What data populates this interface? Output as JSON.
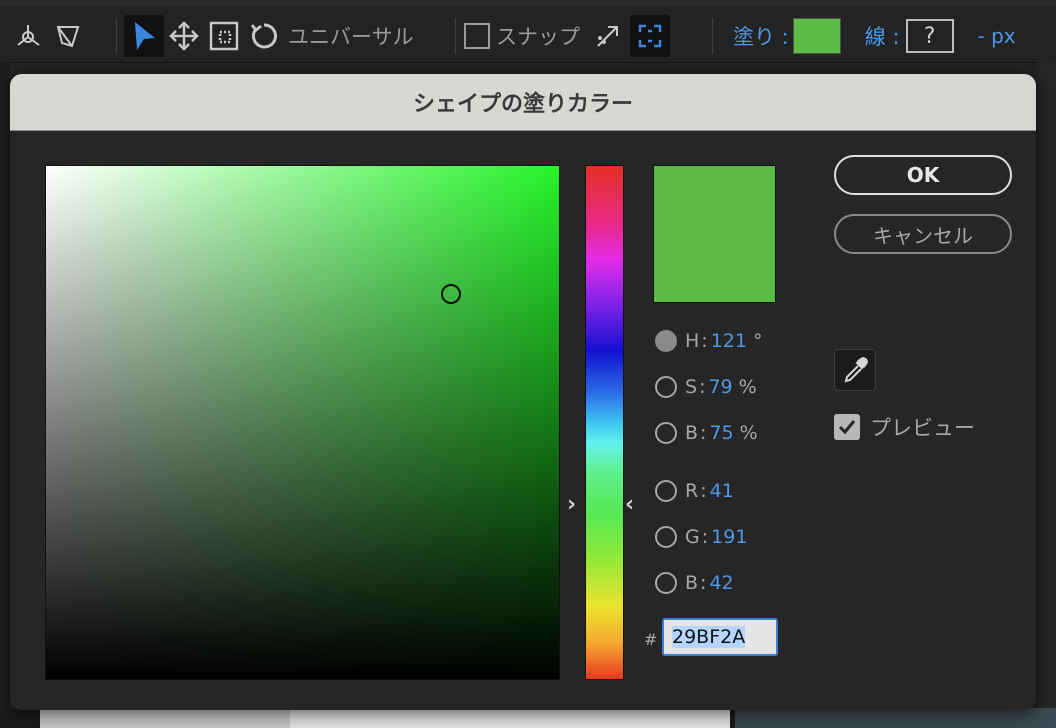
{
  "toolbar": {
    "universal_label": "ユニバーサル",
    "snap_label": "スナップ",
    "fill_label": "塗り :",
    "fill_color": "#5bbd48",
    "stroke_label": "線 :",
    "stroke_value": "?",
    "stroke_unit": "- px",
    "icons": [
      "transform-3d-icon",
      "distort-icon",
      "selection-arrow-icon",
      "move-icon",
      "scale-icon",
      "rotate-icon",
      "snap-checkbox-icon",
      "snap-direction-icon",
      "snap-bounds-icon"
    ]
  },
  "dialog": {
    "title": "シェイプの塗りカラー",
    "ok_label": "OK",
    "cancel_label": "キャンセル",
    "preview_label": "プレビュー",
    "preview_checked": true,
    "current_color": "#5bbb45",
    "fields": {
      "h": {
        "label": "H",
        "value": "121",
        "unit": "°",
        "selected": true
      },
      "s": {
        "label": "S",
        "value": "79",
        "unit": "%",
        "selected": false
      },
      "b": {
        "label": "B",
        "value": "75",
        "unit": "%",
        "selected": false
      },
      "r": {
        "label": "R",
        "value": "41",
        "selected": false
      },
      "g": {
        "label": "G",
        "value": "191",
        "selected": false
      },
      "bl": {
        "label": "B",
        "value": "42",
        "selected": false
      }
    },
    "hex_hash": "#",
    "hex_value": "29BF2A"
  }
}
